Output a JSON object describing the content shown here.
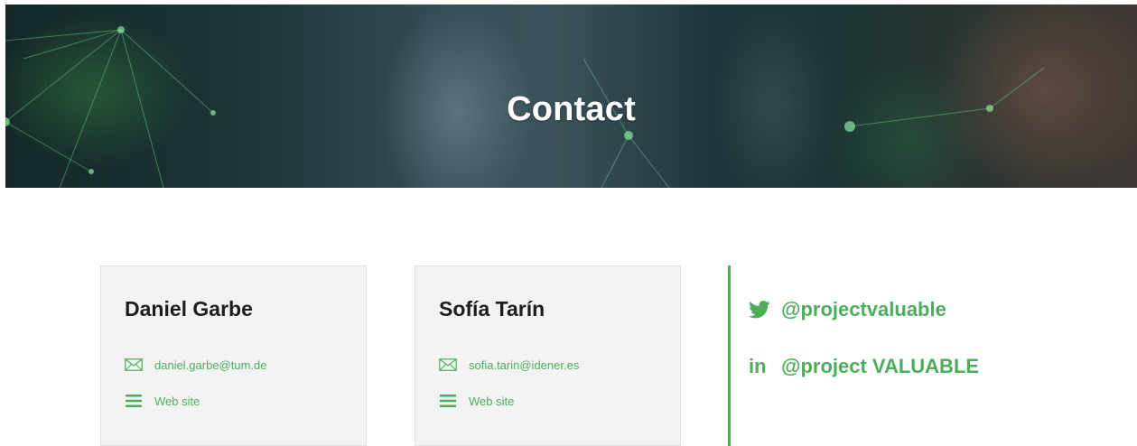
{
  "hero": {
    "title": "Contact"
  },
  "contacts": [
    {
      "name": "Daniel Garbe",
      "email": "daniel.garbe@tum.de",
      "website_label": "Web site"
    },
    {
      "name": "Sofía Tarín",
      "email": "sofia.tarin@idener.es",
      "website_label": "Web site"
    }
  ],
  "social": {
    "twitter_handle": "@projectvaluable",
    "linkedin_handle": "@project VALUABLE",
    "linkedin_glyph": "in"
  },
  "colors": {
    "accent": "#4cae5b",
    "card_bg": "#f3f3f3",
    "heading": "#1d1d1d"
  },
  "icons": [
    "envelope-icon",
    "menu-icon",
    "twitter-icon",
    "linkedin-icon"
  ]
}
